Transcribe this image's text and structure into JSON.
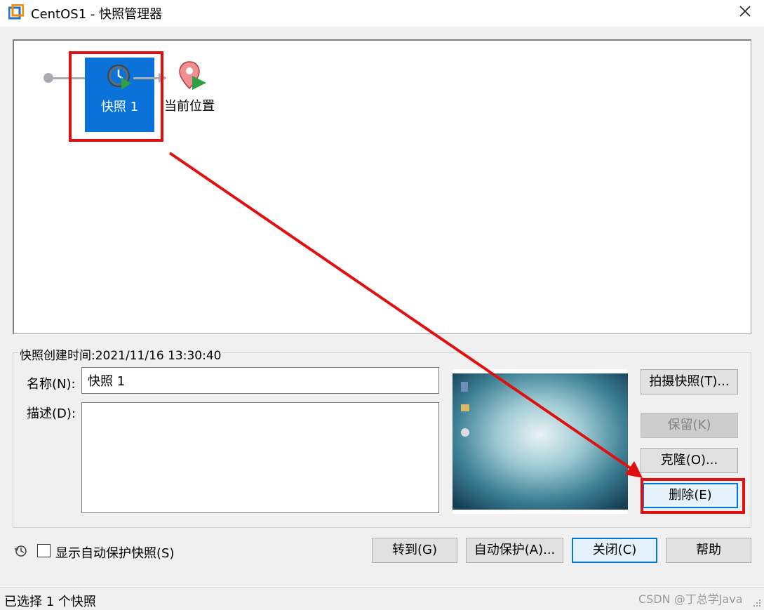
{
  "window": {
    "title": "CentOS1 - 快照管理器"
  },
  "tree": {
    "snapshot_label": "快照 1",
    "current_label": "当前位置"
  },
  "details": {
    "created_label": "快照创建时间:2021/11/16 13:30:40",
    "name_label": "名称(N):",
    "name_value": "快照 1",
    "desc_label": "描述(D):",
    "desc_value": ""
  },
  "side_buttons": {
    "take": "拍摄快照(T)...",
    "keep": "保留(K)",
    "clone": "克隆(O)...",
    "delete": "删除(E)"
  },
  "bottom": {
    "show_auto_label": "显示自动保护快照(S)",
    "show_auto_checked": false,
    "goto": "转到(G)",
    "autoprotect": "自动保护(A)...",
    "close": "关闭(C)",
    "help": "帮助"
  },
  "status": {
    "text": "已选择 1 个快照"
  },
  "watermark": "CSDN @丁总学Java",
  "colors": {
    "selection": "#0a72d8",
    "highlight": "#e01010",
    "focus": "#0078d7"
  },
  "icons": {
    "app": "vmware-icon",
    "close": "close-icon",
    "snapshot": "snapshot-clock-icon",
    "current": "location-pin-icon",
    "history": "history-icon"
  }
}
